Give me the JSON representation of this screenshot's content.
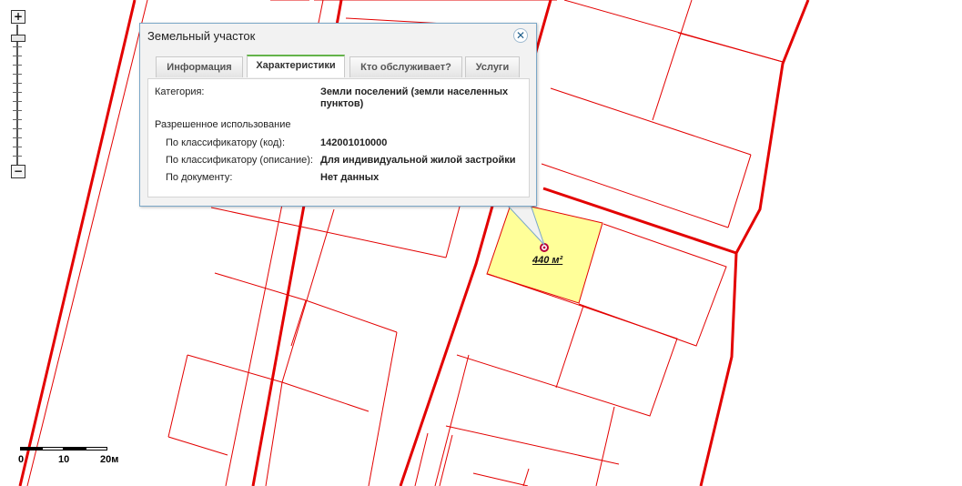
{
  "map": {
    "parcel_fill": "#ffff99",
    "boundary_color": "#e30000",
    "parcel_area_label": "440 м²"
  },
  "zoom": {
    "in_label": "+",
    "out_label": "−"
  },
  "scale": {
    "labels": [
      "0",
      "10",
      "20м"
    ]
  },
  "popup": {
    "title": "Земельный участок",
    "tabs": [
      "Информация",
      "Характеристики",
      "Кто обслуживает?",
      "Услуги"
    ],
    "active_tab": "Характеристики",
    "category_label": "Категория:",
    "category_value": "Земли поселений (земли населенных пунктов)",
    "permitted_use_heading": "Разрешенное использование",
    "rows": [
      {
        "label": "По классификатору (код):",
        "value": "142001010000"
      },
      {
        "label": "По классификатору (описание):",
        "value": "Для индивидуальной жилой застройки"
      },
      {
        "label": "По документу:",
        "value": "Нет данных"
      }
    ]
  }
}
